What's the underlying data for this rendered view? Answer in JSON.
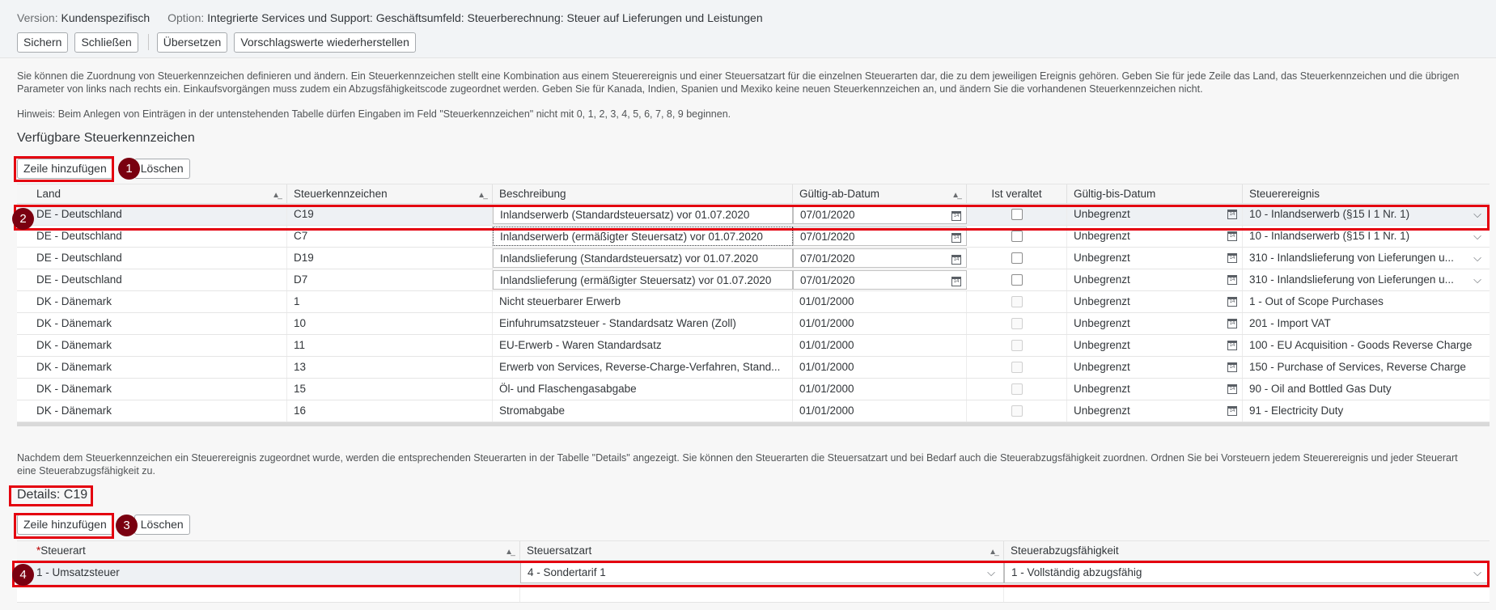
{
  "header": {
    "version_label": "Version:",
    "version_value": "Kundenspezifisch",
    "option_label": "Option:",
    "option_value": "Integrierte Services und Support: Geschäftsumfeld: Steuerberechnung: Steuer auf Lieferungen und Leistungen"
  },
  "toolbar": {
    "save": "Sichern",
    "close": "Schließen",
    "translate": "Übersetzen",
    "restore_defaults": "Vorschlagswerte wiederherstellen"
  },
  "intro_text": "Sie können die Zuordnung von Steuerkennzeichen definieren und ändern. Ein Steuerkennzeichen stellt eine Kombination aus einem Steuerereignis und einer Steuersatzart für die einzelnen Steuerarten dar, die zu dem jeweiligen Ereignis gehören. Geben Sie für jede Zeile das Land, das Steuerkennzeichen und die übrigen Parameter von links nach rechts ein. Einkaufsvorgängen muss zudem ein Abzugsfähigkeitscode zugeordnet werden. Geben Sie für Kanada, Indien, Spanien und Mexiko keine neuen Steuerkennzeichen an, und ändern Sie die vorhandenen Steuerkennzeichen nicht.",
  "hint_text": "Hinweis: Beim Anlegen von Einträgen in der untenstehenden Tabelle dürfen Eingaben im Feld \"Steuerkennzeichen\" nicht mit 0, 1, 2, 3, 4, 5, 6, 7, 8, 9 beginnen.",
  "available": {
    "title": "Verfügbare Steuerkennzeichen",
    "add_row": "Zeile hinzufügen",
    "delete": "Löschen",
    "columns": {
      "land": "Land",
      "code": "Steuerkennzeichen",
      "desc": "Beschreibung",
      "valid_from": "Gültig-ab-Datum",
      "obsolete": "Ist veraltet",
      "valid_to": "Gültig-bis-Datum",
      "event": "Steuerereignis"
    },
    "rows": [
      {
        "land": "DE - Deutschland",
        "code": "C19",
        "desc": "Inlandserwerb (Standardsteuersatz) vor 01.07.2020",
        "valid_from": "07/01/2020",
        "valid_to": "Unbegrenzt",
        "event": "10 - Inlandserwerb (§15 I 1 Nr. 1)"
      },
      {
        "land": "DE - Deutschland",
        "code": "C7",
        "desc": "Inlandserwerb (ermäßigter Steuersatz) vor 01.07.2020",
        "valid_from": "07/01/2020",
        "valid_to": "Unbegrenzt",
        "event": "10 - Inlandserwerb (§15 I 1 Nr. 1)"
      },
      {
        "land": "DE - Deutschland",
        "code": "D19",
        "desc": "Inlandslieferung (Standardsteuersatz) vor 01.07.2020",
        "valid_from": "07/01/2020",
        "valid_to": "Unbegrenzt",
        "event": "310 - Inlandslieferung von Lieferungen u..."
      },
      {
        "land": "DE - Deutschland",
        "code": "D7",
        "desc": "Inlandslieferung (ermäßigter Steuersatz) vor 01.07.2020",
        "valid_from": "07/01/2020",
        "valid_to": "Unbegrenzt",
        "event": "310 - Inlandslieferung von Lieferungen u..."
      },
      {
        "land": "DK - Dänemark",
        "code": "1",
        "desc": "Nicht steuerbarer Erwerb",
        "valid_from": "01/01/2000",
        "valid_to": "Unbegrenzt",
        "event": "1 - Out of Scope Purchases"
      },
      {
        "land": "DK - Dänemark",
        "code": "10",
        "desc": "Einfuhrumsatzsteuer - Standardsatz Waren (Zoll)",
        "valid_from": "01/01/2000",
        "valid_to": "Unbegrenzt",
        "event": "201 - Import VAT"
      },
      {
        "land": "DK - Dänemark",
        "code": "11",
        "desc": "EU-Erwerb - Waren Standardsatz",
        "valid_from": "01/01/2000",
        "valid_to": "Unbegrenzt",
        "event": "100 - EU Acquisition - Goods Reverse Charge"
      },
      {
        "land": "DK - Dänemark",
        "code": "13",
        "desc": "Erwerb von Services, Reverse-Charge-Verfahren, Stand...",
        "valid_from": "01/01/2000",
        "valid_to": "Unbegrenzt",
        "event": "150 - Purchase of Services, Reverse Charge"
      },
      {
        "land": "DK - Dänemark",
        "code": "15",
        "desc": "Öl- und Flaschengasabgabe",
        "valid_from": "01/01/2000",
        "valid_to": "Unbegrenzt",
        "event": "90 - Oil and Bottled Gas Duty"
      },
      {
        "land": "DK - Dänemark",
        "code": "16",
        "desc": "Stromabgabe",
        "valid_from": "01/01/2000",
        "valid_to": "Unbegrenzt",
        "event": "91 - Electricity Duty"
      }
    ]
  },
  "details_text": "Nachdem dem Steuerkennzeichen ein Steuerereignis zugeordnet wurde, werden die entsprechenden Steuerarten in der Tabelle \"Details\" angezeigt. Sie können den Steuerarten die Steuersatzart und bei Bedarf auch die Steuerabzugsfähigkeit zuordnen. Ordnen Sie bei Vorsteuern jedem Steuerereignis und jeder Steuerart eine Steuerabzugsfähigkeit zu.",
  "details": {
    "title": "Details: C19",
    "add_row": "Zeile hinzufügen",
    "delete": "Löschen",
    "columns": {
      "type": "Steuerart",
      "rate": "Steuersatzart",
      "deduct": "Steuerabzugsfähigkeit"
    },
    "rows": [
      {
        "type": "1 - Umsatzsteuer",
        "rate": "4 - Sondertarif 1",
        "deduct": "1 - Vollständig abzugsfähig"
      }
    ]
  },
  "markers": [
    "1",
    "2",
    "3",
    "4"
  ],
  "calendar_icon_text": "14"
}
